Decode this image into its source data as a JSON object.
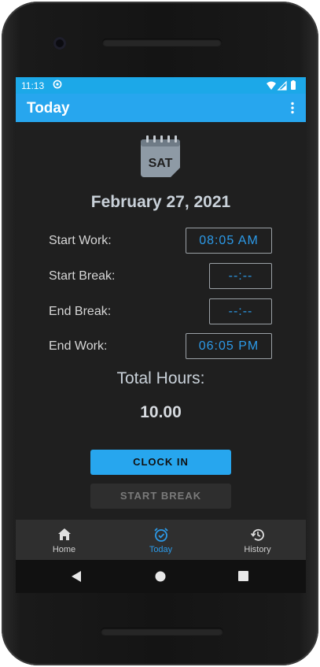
{
  "status_bar": {
    "time": "11:13"
  },
  "app_bar": {
    "title": "Today"
  },
  "calendar_icon_text": "SAT",
  "date": "February 27, 2021",
  "rows": [
    {
      "label": "Start Work:",
      "value": "08:05 AM"
    },
    {
      "label": "Start Break:",
      "value": "--:--"
    },
    {
      "label": "End Break:",
      "value": "--:--"
    },
    {
      "label": "End Work:",
      "value": "06:05 PM"
    }
  ],
  "total": {
    "label": "Total Hours:",
    "value": "10.00"
  },
  "buttons": {
    "clock_in": "CLOCK IN",
    "start_break": "START BREAK"
  },
  "bottom_nav": {
    "items": [
      {
        "label": "Home",
        "icon": "home-icon"
      },
      {
        "label": "Today",
        "icon": "alarm-clock-icon",
        "active": true
      },
      {
        "label": "History",
        "icon": "history-icon"
      }
    ]
  },
  "colors": {
    "accent": "#27a6ee",
    "time_text": "#2c9ae8",
    "background": "#1f1f1f"
  }
}
